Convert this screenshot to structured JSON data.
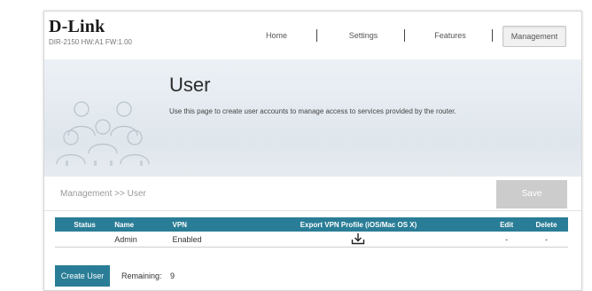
{
  "brand": {
    "logo": "D-Link",
    "model": "DIR-2150 HW:A1 FW:1.00"
  },
  "nav": {
    "items": [
      {
        "label": "Home"
      },
      {
        "label": "Settings"
      },
      {
        "label": "Features"
      },
      {
        "label": "Management",
        "active": true
      }
    ]
  },
  "hero": {
    "title": "User",
    "description": "Use this page to create user accounts to manage access to services provided by the router."
  },
  "breadcrumb": "Management >> User",
  "save_label": "Save",
  "table": {
    "headers": {
      "status": "Status",
      "name": "Name",
      "vpn": "VPN",
      "export": "Export VPN Profile (iOS/Mac OS X)",
      "edit": "Edit",
      "delete": "Delete"
    },
    "rows": [
      {
        "status": "",
        "name": "Admin",
        "vpn": "Enabled",
        "edit": "-",
        "delete": "-"
      }
    ]
  },
  "create_user_label": "Create User",
  "remaining": {
    "label": "Remaining:",
    "count": "9"
  },
  "colors": {
    "accent": "#2a7d96",
    "save_disabled": "#cccccc"
  }
}
